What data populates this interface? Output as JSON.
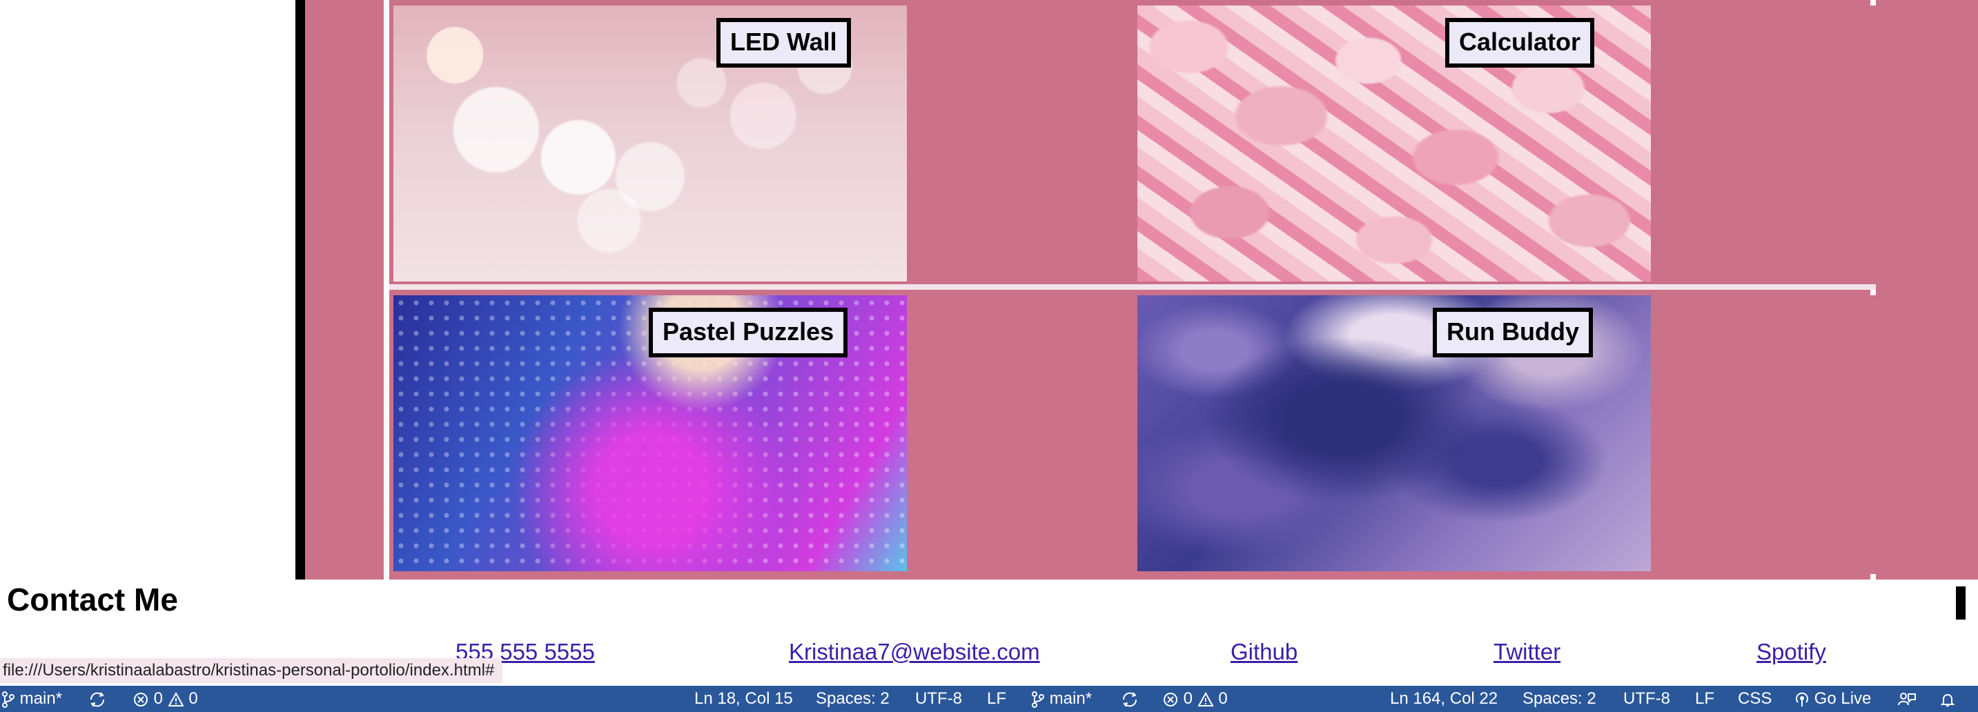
{
  "projects": [
    {
      "label": "LED Wall",
      "image": "bokeh-pink"
    },
    {
      "label": "Calculator",
      "image": "rose-petals"
    },
    {
      "label": "Pastel Puzzles",
      "image": "water-drops"
    },
    {
      "label": "Run Buddy",
      "image": "purple-ink"
    }
  ],
  "contact": {
    "title": "Contact Me",
    "links": [
      "555 555 5555",
      "Kristinaa7@website.com",
      "Github",
      "Twitter",
      "Spotify"
    ]
  },
  "tooltip": {
    "url": "file:///Users/kristinaalabastro/kristinas-personal-portolio/index.html#"
  },
  "statusbar": {
    "left": {
      "branch": "main*",
      "errors": "0",
      "warnings": "0",
      "position": "Ln 18, Col 15",
      "spaces": "Spaces: 2",
      "encoding": "UTF-8",
      "eol": "LF"
    },
    "right": {
      "branch": "main*",
      "errors": "0",
      "warnings": "0",
      "position": "Ln 164, Col 22",
      "spaces": "Spaces: 2",
      "encoding": "UTF-8",
      "eol": "LF",
      "language": "CSS",
      "go_live": "Go Live"
    }
  },
  "colors": {
    "card_bg": "#cb7189",
    "statusbar": "#2a579a",
    "link": "#3a1fa8"
  }
}
